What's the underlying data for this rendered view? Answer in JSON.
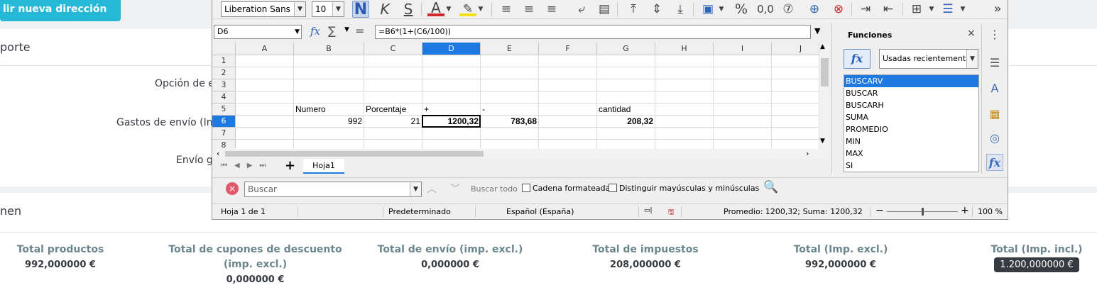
{
  "page": {
    "add_address_button": "lir nueva dirección",
    "shipping_section_title": "porte",
    "shipping_option_label": "Opción de e",
    "shipping_cost_label": "Gastos de envío (Imp",
    "free_shipping_label": "Envío gr",
    "summary_section_title": "nen",
    "totals": [
      {
        "label": "Total productos",
        "value": "992,000000 €"
      },
      {
        "label": "Total de cupones de descuento (imp. excl.)",
        "value": "0,000000 €"
      },
      {
        "label": "Total de envío (imp. excl.)",
        "value": "0,000000 €"
      },
      {
        "label": "Total de impuestos",
        "value": "208,000000 €"
      },
      {
        "label": "Total (Imp. excl.)",
        "value": "992,000000 €"
      },
      {
        "label": "Total (Imp. incl.)",
        "value": "1.200,000000 €"
      }
    ]
  },
  "calc": {
    "font_name": "Liberation Sans",
    "font_size": "10",
    "toolbar": {
      "bold": "N",
      "italic": "K",
      "underline": "S",
      "font_color": "A",
      "percent": "%",
      "decimal": "0,0",
      "more": "»"
    },
    "name_box": "D6",
    "formula": "=B6*(1+(C6/100))",
    "columns": [
      "A",
      "B",
      "C",
      "D",
      "E",
      "F",
      "G",
      "H",
      "I",
      "J"
    ],
    "rows": [
      "1",
      "2",
      "3",
      "4",
      "5",
      "6",
      "7",
      "8"
    ],
    "cells": {
      "B5": "Numero",
      "C5": "Porcentaje",
      "D5": "+",
      "E5": "-",
      "G5": "cantidad",
      "B6": "992",
      "C6": "21",
      "D6": "1200,32",
      "E6": "783,68",
      "G6": "208,32"
    },
    "sheet_tab": "Hoja1",
    "find": {
      "placeholder": "Buscar",
      "find_all": "Buscar todo",
      "formatted": "Cadena formateada",
      "match_case": "Distinguir mayúsculas y minúsculas"
    },
    "status": {
      "sheet": "Hoja 1 de 1",
      "style": "Predeterminado",
      "language": "Español (España)",
      "sum": "Promedio: 1200,32; Suma: 1200,32",
      "zoom": "100 %",
      "zoom_level": 0.5
    },
    "sidebar": {
      "title": "Funciones",
      "category": "Usadas recientemente",
      "functions": [
        "BUSCARV",
        "BUSCAR",
        "BUSCARH",
        "SUMA",
        "PROMEDIO",
        "MIN",
        "MAX",
        "SI"
      ]
    }
  }
}
